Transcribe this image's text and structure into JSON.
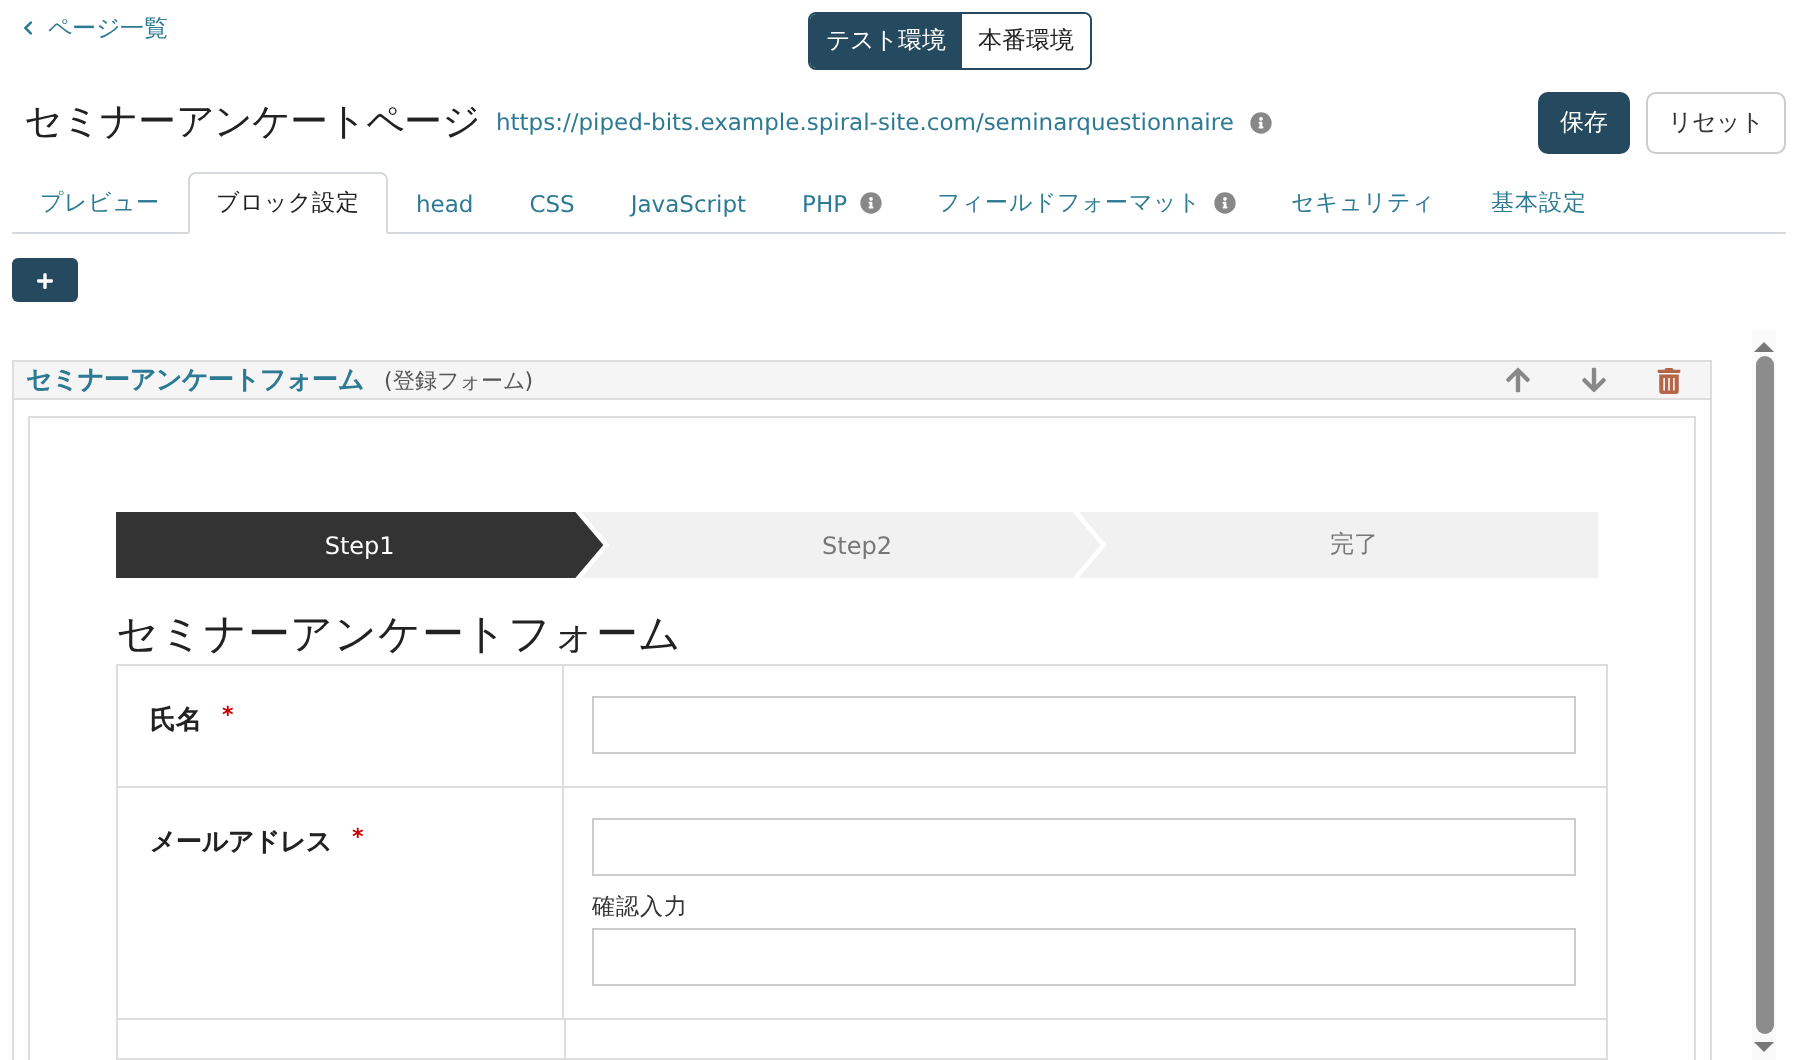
{
  "back_link": "ページ一覧",
  "environments": [
    {
      "label": "テスト環境",
      "selected": true
    },
    {
      "label": "本番環境",
      "selected": false
    }
  ],
  "page": {
    "title": "セミナーアンケートページ",
    "url": "https://piped-bits.example.spiral-site.com/seminarquestionnaire"
  },
  "actions": [
    {
      "label": "保存",
      "kind": "primary"
    },
    {
      "label": "リセット",
      "kind": "secondary"
    }
  ],
  "tabs": [
    {
      "label": "プレビュー",
      "selected": false,
      "info": false
    },
    {
      "label": "ブロック設定",
      "selected": true,
      "info": false
    },
    {
      "label": "head",
      "selected": false,
      "info": false
    },
    {
      "label": "CSS",
      "selected": false,
      "info": false
    },
    {
      "label": "JavaScript",
      "selected": false,
      "info": false
    },
    {
      "label": "PHP",
      "selected": false,
      "info": true
    },
    {
      "label": "フィールドフォーマット",
      "selected": false,
      "info": true
    },
    {
      "label": "セキュリティ",
      "selected": false,
      "info": false
    },
    {
      "label": "基本設定",
      "selected": false,
      "info": false
    }
  ],
  "block": {
    "title": "セミナーアンケートフォーム",
    "type_label": "(登録フォーム)",
    "form": {
      "steps": [
        {
          "label": "Step1",
          "selected": true
        },
        {
          "label": "Step2",
          "selected": false
        },
        {
          "label": "完了",
          "selected": false
        }
      ],
      "title": "セミナーアンケートフォーム",
      "fields": [
        {
          "label": "氏名",
          "required": true,
          "required_mark": "*"
        },
        {
          "label": "メールアドレス",
          "required": true,
          "required_mark": "*",
          "confirm_label": "確認入力"
        }
      ]
    }
  }
}
